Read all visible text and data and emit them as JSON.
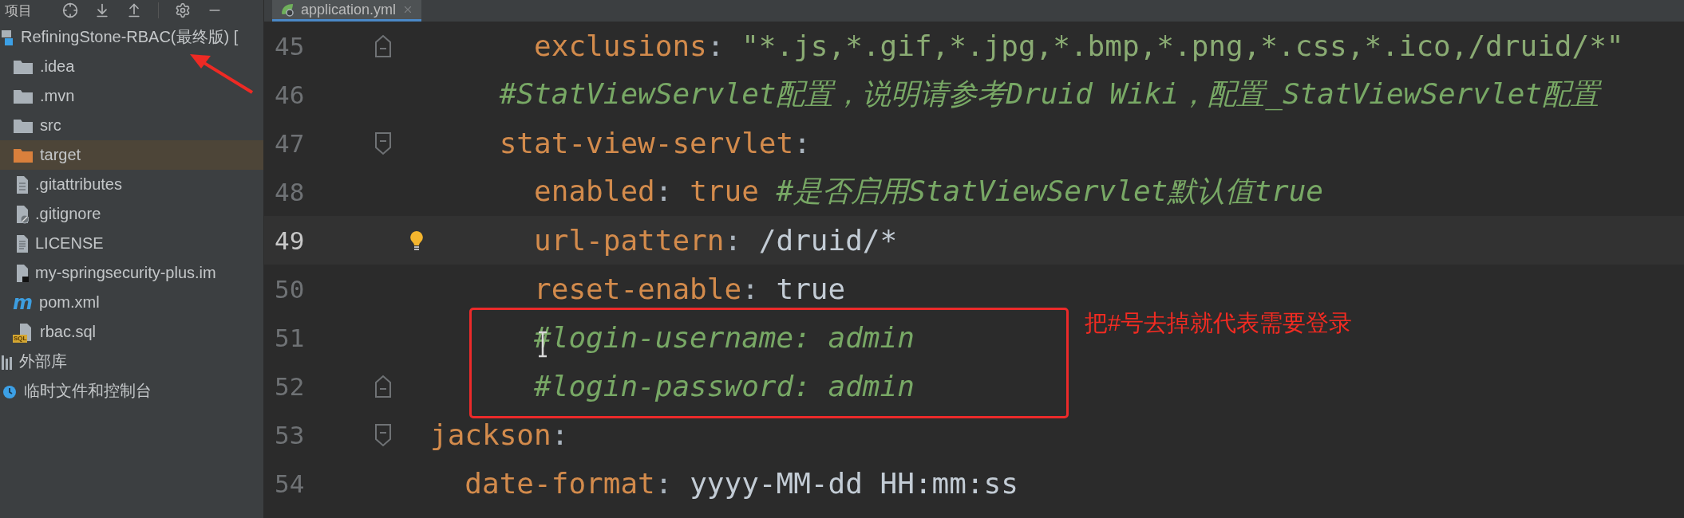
{
  "project_panel": {
    "title": "项目",
    "tree": [
      {
        "label": "RefiningStone-RBAC(最终版) [",
        "kind": "module",
        "selected": false,
        "children": [
          {
            "label": ".idea",
            "kind": "folder",
            "selected": false
          },
          {
            "label": ".mvn",
            "kind": "folder",
            "selected": false
          },
          {
            "label": "src",
            "kind": "folder",
            "selected": false
          },
          {
            "label": "target",
            "kind": "excluded_folder",
            "selected": true
          },
          {
            "label": ".gitattributes",
            "kind": "file",
            "selected": false
          },
          {
            "label": ".gitignore",
            "kind": "ignore_file",
            "selected": false
          },
          {
            "label": "LICENSE",
            "kind": "text_file",
            "selected": false
          },
          {
            "label": "my-springsecurity-plus.im",
            "kind": "module_file",
            "selected": false
          },
          {
            "label": "pom.xml",
            "kind": "maven",
            "glyph": "m",
            "selected": false
          },
          {
            "label": "rbac.sql",
            "kind": "sql",
            "badge": "SQL",
            "selected": false
          }
        ]
      },
      {
        "label": "外部库",
        "kind": "library",
        "selected": false
      },
      {
        "label": "临时文件和控制台",
        "kind": "scratch",
        "selected": false
      }
    ]
  },
  "editor": {
    "tabs": [
      {
        "label": "application.yml",
        "selected": true
      }
    ],
    "lines": [
      {
        "number": "45",
        "fold_start": false,
        "fold_end": true,
        "current": false,
        "hint": false,
        "cursor": false,
        "tokens": [
          {
            "kind": "key",
            "text": "      exclusions"
          },
          {
            "kind": "punct",
            "text": ": "
          },
          {
            "kind": "string",
            "text": "\"*.js,*.gif,*.jpg,*.bmp,*.png,*.css,*.ico,/druid/*\""
          }
        ]
      },
      {
        "number": "46",
        "fold_start": false,
        "fold_end": false,
        "current": false,
        "hint": false,
        "cursor": false,
        "tokens": [
          {
            "kind": "comment",
            "text": "    #StatViewServlet配置，说明请参考Druid Wiki，配置_StatViewServlet配置"
          }
        ]
      },
      {
        "number": "47",
        "fold_start": true,
        "fold_end": false,
        "current": false,
        "hint": false,
        "cursor": false,
        "tokens": [
          {
            "kind": "key",
            "text": "    stat-view-servlet"
          },
          {
            "kind": "punct",
            "text": ":"
          }
        ]
      },
      {
        "number": "48",
        "fold_start": false,
        "fold_end": false,
        "current": false,
        "hint": false,
        "cursor": false,
        "tokens": [
          {
            "kind": "key",
            "text": "      enabled"
          },
          {
            "kind": "punct",
            "text": ": "
          },
          {
            "kind": "value",
            "text": "true"
          },
          {
            "kind": "comment",
            "text": " #是否启用StatViewServlet默认值true"
          }
        ]
      },
      {
        "number": "49",
        "fold_start": false,
        "fold_end": false,
        "current": true,
        "hint": true,
        "cursor": false,
        "tokens": [
          {
            "kind": "key",
            "text": "      url-pattern"
          },
          {
            "kind": "punct",
            "text": ": "
          },
          {
            "kind": "plain",
            "text": "/druid/*"
          }
        ]
      },
      {
        "number": "50",
        "fold_start": false,
        "fold_end": false,
        "current": false,
        "hint": false,
        "cursor": false,
        "tokens": [
          {
            "kind": "key",
            "text": "      reset-enable"
          },
          {
            "kind": "punct",
            "text": ": "
          },
          {
            "kind": "plain",
            "text": "true"
          }
        ]
      },
      {
        "number": "51",
        "fold_start": false,
        "fold_end": false,
        "current": false,
        "hint": false,
        "cursor": true,
        "tokens": [
          {
            "kind": "comment",
            "text": "      #login-username: admin"
          }
        ]
      },
      {
        "number": "52",
        "fold_start": false,
        "fold_end": true,
        "current": false,
        "hint": false,
        "cursor": false,
        "tokens": [
          {
            "kind": "comment",
            "text": "      #login-password: admin"
          }
        ]
      },
      {
        "number": "53",
        "fold_start": true,
        "fold_end": false,
        "current": false,
        "hint": false,
        "cursor": false,
        "tokens": [
          {
            "kind": "key",
            "text": "jackson"
          },
          {
            "kind": "punct",
            "text": ":"
          }
        ]
      },
      {
        "number": "54",
        "fold_start": false,
        "fold_end": false,
        "current": false,
        "hint": false,
        "cursor": false,
        "tokens": [
          {
            "kind": "key",
            "text": "  date-format"
          },
          {
            "kind": "punct",
            "text": ": "
          },
          {
            "kind": "plain",
            "text": "yyyy-MM-dd HH:mm:ss"
          }
        ]
      }
    ]
  },
  "annotations": [
    {
      "kind": "arrow"
    },
    {
      "kind": "box"
    },
    {
      "kind": "note",
      "text": "把#号去掉就代表需要登录"
    }
  ]
}
